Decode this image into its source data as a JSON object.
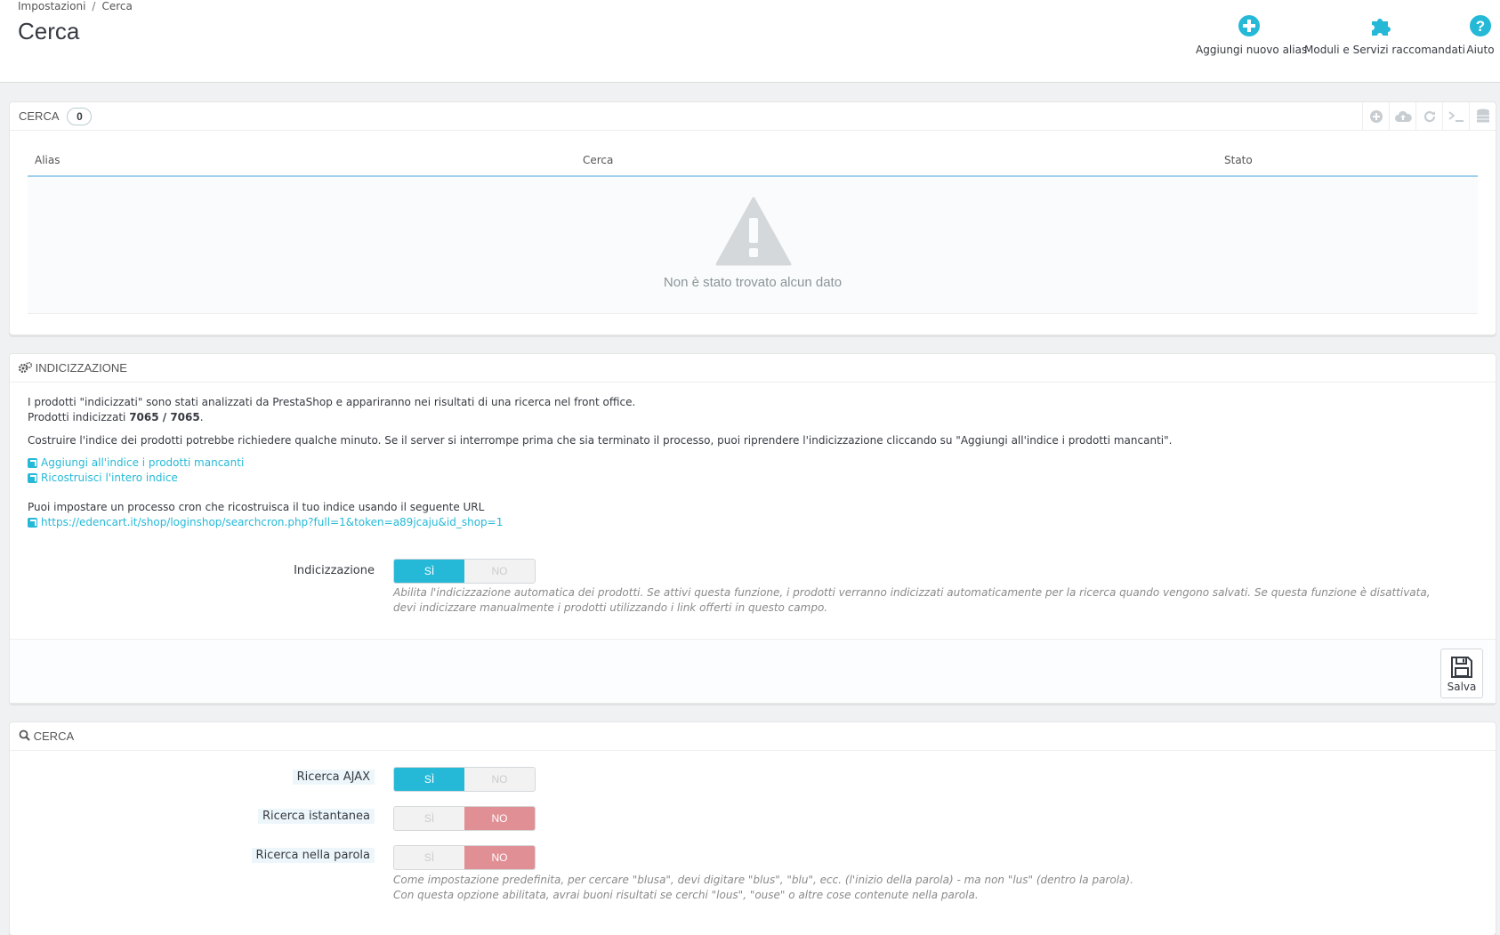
{
  "breadcrumb": {
    "parent": "Impostazioni",
    "separator": "/",
    "current": "Cerca"
  },
  "page_title": "Cerca",
  "toolbar": {
    "add_alias": "Aggiungi nuovo alias",
    "modules": "Moduli e Servizi raccomandati",
    "help": "Aiuto"
  },
  "aliases_panel": {
    "title": "Cerca",
    "count": "0",
    "columns": [
      "Alias",
      "Cerca",
      "Stato"
    ],
    "empty_message": "Non è stato trovato alcun dato",
    "tools": [
      "add-icon",
      "cloud-upload-icon",
      "refresh-icon",
      "terminal-icon",
      "database-icon"
    ]
  },
  "indexing_panel": {
    "title": "Indicizzazione",
    "intro_line1": "I prodotti \"indicizzati\" sono stati analizzati da PrestaShop e appariranno nei risultati di una ricerca nel front office.",
    "indexed_label": "Prodotti indicizzati ",
    "indexed_value": "7065 / 7065",
    "indexed_suffix": ".",
    "rebuild_note": "Costruire l'indice dei prodotti potrebbe richiedere qualche minuto. Se il server si interrompe prima che sia terminato il processo, puoi riprendere l'indicizzazione cliccando su \"Aggiungi all'indice i prodotti mancanti\".",
    "link_add_missing": "Aggiungi all'indice i prodotti mancanti",
    "link_rebuild": "Ricostruisci l'intero indice",
    "cron_note": "Puoi impostare un processo cron che ricostruisca il tuo indice usando il seguente URL",
    "cron_url": "https://edencart.it/shop/loginshop/searchcron.php?full=1&token=a89jcaju&id_shop=1",
    "field_label": "Indicizzazione",
    "yes": "SÌ",
    "no": "NO",
    "help_text": "Abilita l'indicizzazione automatica dei prodotti. Se attivi questa funzione, i prodotti verranno indicizzati automaticamente per la ricerca quando vengono salvati. Se questa funzione è disattivata, devi indicizzare manualmente i prodotti utilizzando i link offerti in questo campo.",
    "save_label": "Salva"
  },
  "search_panel": {
    "title": "Cerca",
    "ajax_label": "Ricerca AJAX",
    "instant_label": "Ricerca istantanea",
    "inword_label": "Ricerca nella parola",
    "yes": "SÌ",
    "no": "NO",
    "help_line1": "Come impostazione predefinita, per cercare \"blusa\", devi digitare \"blus\", \"blu\", ecc. (l'inizio della parola) - ma non \"lus\" (dentro la parola).",
    "help_line2": "Con questa opzione abilitata, avrai buoni risultati se cerchi \"lous\", \"ouse\" o altre cose contenute nella parola."
  },
  "colors": {
    "accent": "#25b9d7",
    "no_active": "#e08f95"
  }
}
